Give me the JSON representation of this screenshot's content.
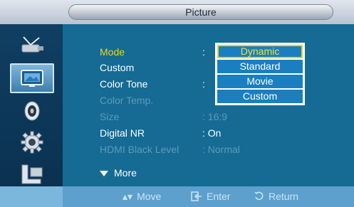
{
  "header": {
    "title": "Picture"
  },
  "sidebar": {
    "items": [
      {
        "icon": "antenna-icon",
        "active": false
      },
      {
        "icon": "picture-icon",
        "active": true
      },
      {
        "icon": "sound-icon",
        "active": false
      },
      {
        "icon": "setup-gear-icon",
        "active": false
      },
      {
        "icon": "input-icon",
        "active": false
      }
    ]
  },
  "menu": {
    "rows": [
      {
        "label": "Mode",
        "value": ":"
      },
      {
        "label": "Custom",
        "value": ""
      },
      {
        "label": "Color Tone",
        "value": ":"
      },
      {
        "label": "Color Temp.",
        "value": ""
      },
      {
        "label": "Size",
        "value": ": 16:9"
      },
      {
        "label": "Digital NR",
        "value": ": On"
      },
      {
        "label": "HDMI Black Level",
        "value": ": Normal"
      }
    ],
    "more_label": "More"
  },
  "dropdown": {
    "options": [
      "Dynamic",
      "Standard",
      "Movie",
      "Custom"
    ],
    "selected": "Dynamic"
  },
  "footer": {
    "move_label": "Move",
    "enter_label": "Enter",
    "return_label": "Return"
  },
  "colors": {
    "accent_yellow": "#f2d21a",
    "panel_blue": "#156b93",
    "sidebar_dark": "#0f3f63",
    "footer_blue": "#5d9fcd"
  }
}
